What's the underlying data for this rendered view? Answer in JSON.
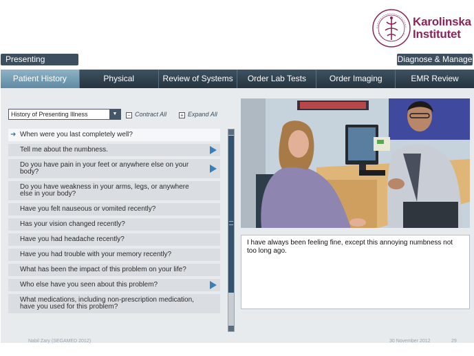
{
  "brand": {
    "line1": "Karolinska",
    "line2": "Institutet",
    "color": "#8b2458"
  },
  "header": {
    "left_label": "Presenting Complaint",
    "right_label": "Diagnose & Manage Pt."
  },
  "tabs": [
    {
      "label": "Patient History",
      "active": true
    },
    {
      "label": "Physical Examination",
      "active": false
    },
    {
      "label": "Review of Systems",
      "active": false
    },
    {
      "label": "Order Lab Tests",
      "active": false
    },
    {
      "label": "Order Imaging",
      "active": false
    },
    {
      "label": "EMR Review",
      "active": false
    }
  ],
  "toolbar": {
    "category_select": "History of Presenting Illness",
    "contract_all": "Contract All",
    "expand_all": "Expand All"
  },
  "questions": [
    {
      "text": "When were you last completely well?",
      "selected": true,
      "has_arrow": false
    },
    {
      "text": "Tell me about the numbness.",
      "selected": false,
      "has_arrow": true
    },
    {
      "text": "Do you have pain in your feet or anywhere else on your body?",
      "selected": false,
      "has_arrow": true
    },
    {
      "text": "Do you have weakness in your arms, legs, or anywhere else in your body?",
      "selected": false,
      "has_arrow": false
    },
    {
      "text": "Have you felt nauseous or vomited recently?",
      "selected": false,
      "has_arrow": false
    },
    {
      "text": "Has your vision changed recently?",
      "selected": false,
      "has_arrow": false
    },
    {
      "text": "Have you had headache recently?",
      "selected": false,
      "has_arrow": false
    },
    {
      "text": "Have you had trouble with your memory recently?",
      "selected": false,
      "has_arrow": false
    },
    {
      "text": "What has been the impact of this problem on your life?",
      "selected": false,
      "has_arrow": false
    },
    {
      "text": "Who else have you seen about this problem?",
      "selected": false,
      "has_arrow": true
    },
    {
      "text": "What medications, including non-prescription medication, have you used for this problem?",
      "selected": false,
      "has_arrow": false
    }
  ],
  "response": "I have always been feeling fine, except this annoying numbness not too long ago.",
  "footer": {
    "author": "Nabil Zary (SEGAMED  2012)",
    "date": "30 November 2012",
    "page": "29"
  }
}
